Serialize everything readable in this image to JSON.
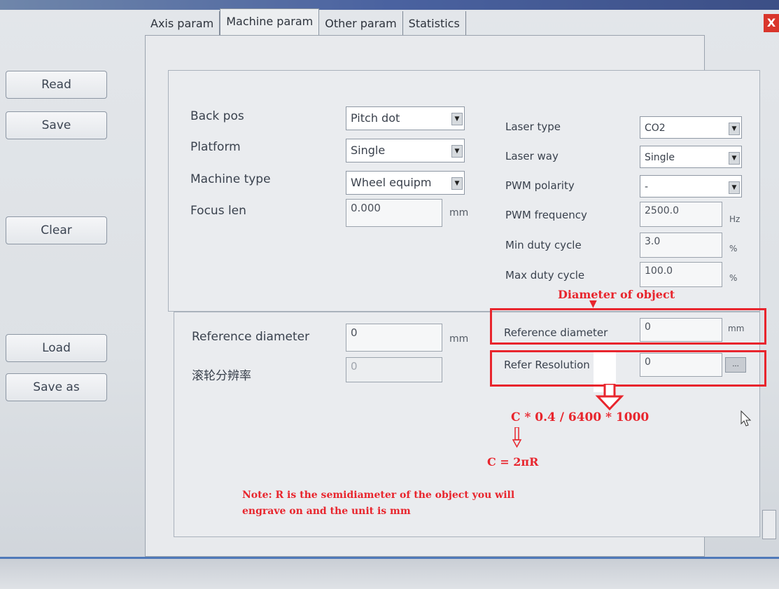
{
  "tabs": [
    "Axis param",
    "Machine param",
    "Other param",
    "Statistics"
  ],
  "close_label": "X",
  "left_buttons": {
    "read": "Read",
    "save": "Save",
    "clear": "Clear",
    "load": "Load",
    "save_as": "Save as"
  },
  "left_params": {
    "back_pos": {
      "label": "Back pos",
      "value": "Pitch dot"
    },
    "platform": {
      "label": "Platform",
      "value": "Single"
    },
    "machine_type": {
      "label": "Machine type",
      "value": "Wheel equipm"
    },
    "focus_len": {
      "label": "Focus len",
      "value": "0.000",
      "unit": "mm"
    }
  },
  "right_params": {
    "laser_type": {
      "label": "Laser type",
      "value": "CO2"
    },
    "laser_way": {
      "label": "Laser way",
      "value": "Single"
    },
    "pwm_polarity": {
      "label": "PWM polarity",
      "value": "-"
    },
    "pwm_frequency": {
      "label": "PWM frequency",
      "value": "2500.0",
      "unit": "Hz"
    },
    "min_duty": {
      "label": "Min duty cycle",
      "value": "3.0",
      "unit": "%"
    },
    "max_duty": {
      "label": "Max duty cycle",
      "value": "100.0",
      "unit": "%"
    }
  },
  "lower_left": {
    "ref_diameter": {
      "label": "Reference diameter",
      "value": "0",
      "unit": "mm"
    },
    "roller_res": {
      "label": "滚轮分辨率",
      "value": "0"
    }
  },
  "lower_right": {
    "ref_diameter": {
      "label": "Reference diameter",
      "value": "0",
      "unit": "mm"
    },
    "refer_resolution": {
      "label": "Refer Resolution",
      "value": "0"
    }
  },
  "annotations": {
    "diameter": "Diameter of object",
    "formula": "C * 0.4 / 6400 * 1000",
    "circumference": "C = 2πR",
    "note_line1": "Note: R is the semidiameter of the object you will",
    "note_line2": "engrave on and the unit is mm"
  },
  "colors": {
    "annotation_red": "#e8252d",
    "title_bar": "#4a62a0"
  }
}
